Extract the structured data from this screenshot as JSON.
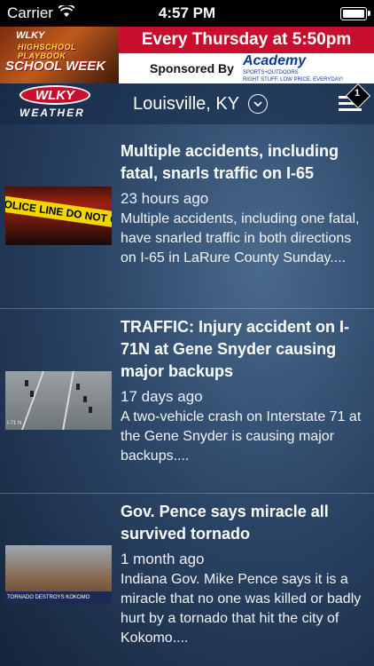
{
  "status_bar": {
    "carrier": "Carrier",
    "time": "4:57 PM"
  },
  "ad": {
    "left_line1": "WLKY",
    "left_line2": "HIGHSCHOOL PLAYBOOK",
    "left_line3": "SCHOOL WEEK",
    "headline": "Every Thursday at 5:50pm",
    "sponsored_by": "Sponsored By",
    "brand": "Academy",
    "brand_sub": "SPORTS+OUTDOORS",
    "tagline": "RIGHT STUFF. LOW PRICE. EVERYDAY!"
  },
  "header": {
    "logo_text": "WLKY",
    "logo_sub": "WEATHER",
    "location": "Louisville, KY",
    "menu_badge": "1"
  },
  "articles": [
    {
      "title": "Multiple accidents, including fatal, snarls traffic on I-65",
      "time": "23 hours ago",
      "description": "Multiple accidents, including one fatal, have snarled traffic in both directions on I-65 in LaRure County Sunday....",
      "thumb_text": "POLICE LINE DO NOT CROSS"
    },
    {
      "title": "TRAFFIC: Injury accident on I-71N at Gene Snyder causing major backups",
      "time": "17 days ago",
      "description": "A two-vehicle crash on Interstate 71 at the Gene Snyder is causing major backups....",
      "thumb_text": "I-71 N"
    },
    {
      "title": "Gov. Pence says miracle all survived tornado",
      "time": "1 month ago",
      "description": "Indiana Gov. Mike Pence says it is a miracle that no one was killed or badly hurt by a tornado that hit the city of Kokomo....",
      "thumb_text": "TORNADO DESTROYS KOKOMO"
    }
  ],
  "colors": {
    "ad_red": "#c8102e",
    "brand_blue": "#0b3a8c",
    "bg_dark": "#15243a"
  },
  "icons": [
    "wifi-icon",
    "battery-icon",
    "chevron-down-icon",
    "hamburger-menu-icon"
  ]
}
